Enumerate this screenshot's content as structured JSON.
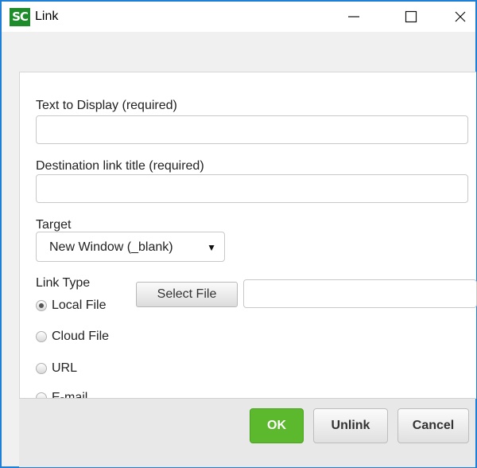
{
  "window": {
    "app_icon_text": "SC",
    "title": "Link",
    "minimize_glyph": "—",
    "maximize_glyph": "☐",
    "close_glyph": "✕"
  },
  "form": {
    "display_text": {
      "label": "Text to Display (required)",
      "value": "",
      "placeholder": ""
    },
    "link_title": {
      "label": "Destination link title (required)",
      "value": "",
      "placeholder": ""
    },
    "target": {
      "label": "Target",
      "selected": "New Window (_blank)",
      "caret": "▼"
    },
    "link_type": {
      "label": "Link Type",
      "options": [
        {
          "label": "Local File",
          "checked": true
        },
        {
          "label": "Cloud File",
          "checked": false
        },
        {
          "label": "URL",
          "checked": false
        },
        {
          "label": "E-mail",
          "checked": false
        }
      ]
    },
    "select_file_label": "Select File",
    "file_value": ""
  },
  "footer": {
    "ok_label": "OK",
    "unlink_label": "Unlink",
    "cancel_label": "Cancel"
  },
  "colors": {
    "window_border": "#1f7fd6",
    "app_icon_bg": "#1e8c2a",
    "ok_button": "#5cb82c"
  }
}
